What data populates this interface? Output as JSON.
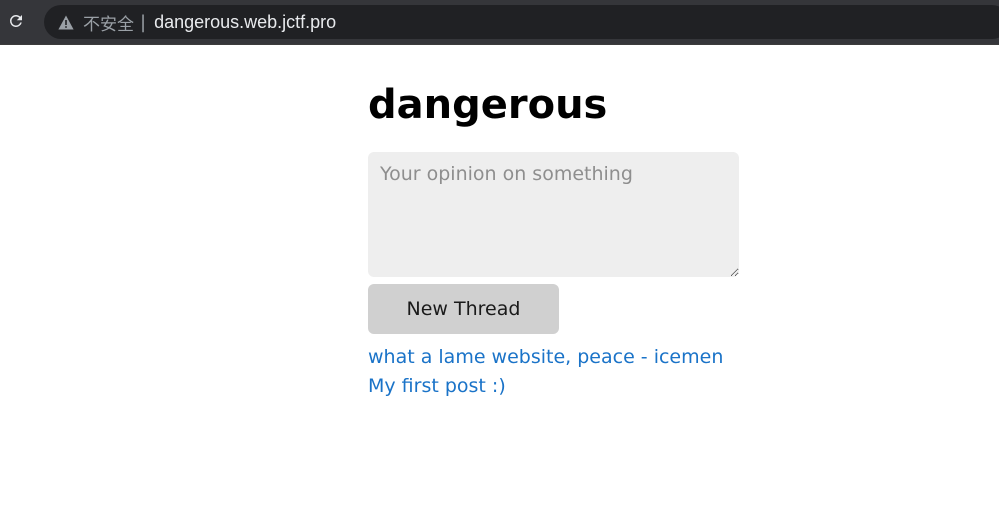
{
  "browser": {
    "security_label": "不安全",
    "separator": "|",
    "url": "dangerous.web.jctf.pro"
  },
  "page": {
    "title": "dangerous",
    "textarea_placeholder": "Your opinion on something",
    "textarea_value": "",
    "button_label": "New Thread",
    "threads": [
      {
        "title": "what a lame website, peace - icemen"
      },
      {
        "title": "My first post :)"
      }
    ]
  },
  "colors": {
    "link": "#1a73c8",
    "textarea_bg": "#eeeeee",
    "button_bg": "#d0d0d0",
    "chrome_bg": "#35363a",
    "omnibox_bg": "#202124"
  }
}
